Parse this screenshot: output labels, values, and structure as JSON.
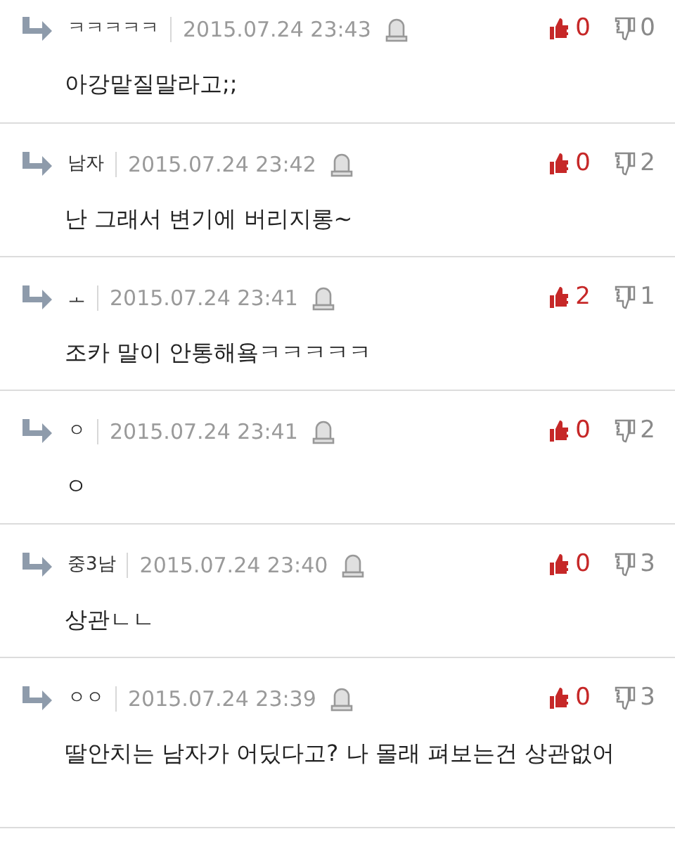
{
  "comments": [
    {
      "author": "ㅋㅋㅋㅋㅋ",
      "date": "2015.07.24 23:43",
      "likes": "0",
      "dislikes": "0",
      "text": "아강맡질말라고;;"
    },
    {
      "author": "남자",
      "date": "2015.07.24 23:42",
      "likes": "0",
      "dislikes": "2",
      "text": "난 그래서 변기에 버리지롱~"
    },
    {
      "author": "ㅗ",
      "date": "2015.07.24 23:41",
      "likes": "2",
      "dislikes": "1",
      "text": "조카 말이 안통해욬ㅋㅋㅋㅋㅋ"
    },
    {
      "author": "ㅇ",
      "date": "2015.07.24 23:41",
      "likes": "0",
      "dislikes": "2",
      "text": "ㅇ"
    },
    {
      "author": "중3남",
      "date": "2015.07.24 23:40",
      "likes": "0",
      "dislikes": "3",
      "text": "상관ㄴㄴ"
    },
    {
      "author": "ㅇㅇ",
      "date": "2015.07.24 23:39",
      "likes": "0",
      "dislikes": "3",
      "text": "딸안치는 남자가 어딨다고? 나 몰래 펴보는건 상관없어"
    }
  ]
}
